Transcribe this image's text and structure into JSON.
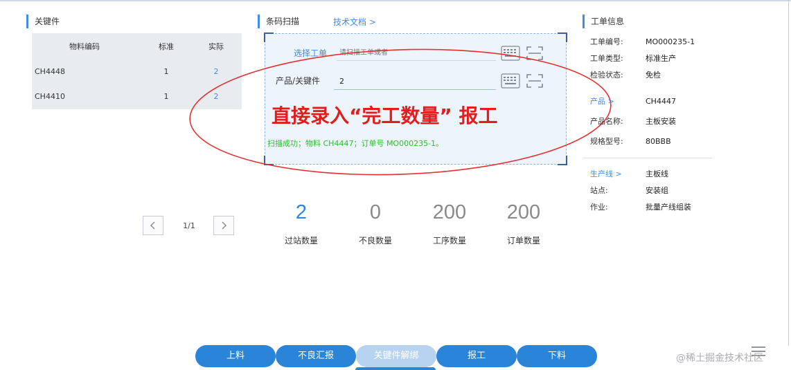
{
  "key_parts": {
    "title": "关键件",
    "headers": {
      "code": "物料编码",
      "standard": "标准",
      "actual": "实际"
    },
    "rows": [
      {
        "code": "CH4448",
        "standard": "1",
        "actual": "2"
      },
      {
        "code": "CH4410",
        "standard": "1",
        "actual": "2"
      }
    ],
    "pager": {
      "text": "1/1"
    }
  },
  "scan": {
    "title": "条码扫描",
    "doc_link": "技术文档 >",
    "work_order_label": "选择工单",
    "work_order_placeholder": "请扫描工单或者",
    "key_part_label": "产品/关键件",
    "key_part_value": "2",
    "message": "扫描成功；物料 CH4447；订单号 MO000235-1。",
    "annotation": "直接录入“完工数量” 报工",
    "annotation_color": "#e11d1d",
    "message_color": "#2bc02b"
  },
  "stats": [
    {
      "value": "2",
      "label": "过站数量"
    },
    {
      "value": "0",
      "label": "不良数量"
    },
    {
      "value": "200",
      "label": "工序数量"
    },
    {
      "value": "200",
      "label": "订单数量"
    }
  ],
  "work_order_info": {
    "title": "工单信息",
    "order_number": {
      "label": "工单编号:",
      "value": "MO000235-1"
    },
    "order_type": {
      "label": "工单类型:",
      "value": "标准生产"
    },
    "inspection": {
      "label": "检验状态:",
      "value": "免检"
    },
    "product_link": {
      "label": "产品 >",
      "value": "CH4447"
    },
    "product_name": {
      "label": "产品名称:",
      "value": "主板安装"
    },
    "spec": {
      "label": "规格型号:",
      "value": "80BBB"
    },
    "line_link": {
      "label": "生产线 >",
      "value": "主板线"
    },
    "station": {
      "label": "站点:",
      "value": "安装组"
    },
    "operation": {
      "label": "作业:",
      "value": "批量产线组装"
    }
  },
  "actions": {
    "load": "上料",
    "defect_report": "不良汇报",
    "unbind": "关键件解绑",
    "report": "报工",
    "unload": "下料"
  },
  "watermark": "@稀土掘金技术社区",
  "colors": {
    "accent": "#2a85d8",
    "link": "#3d8ee8"
  }
}
